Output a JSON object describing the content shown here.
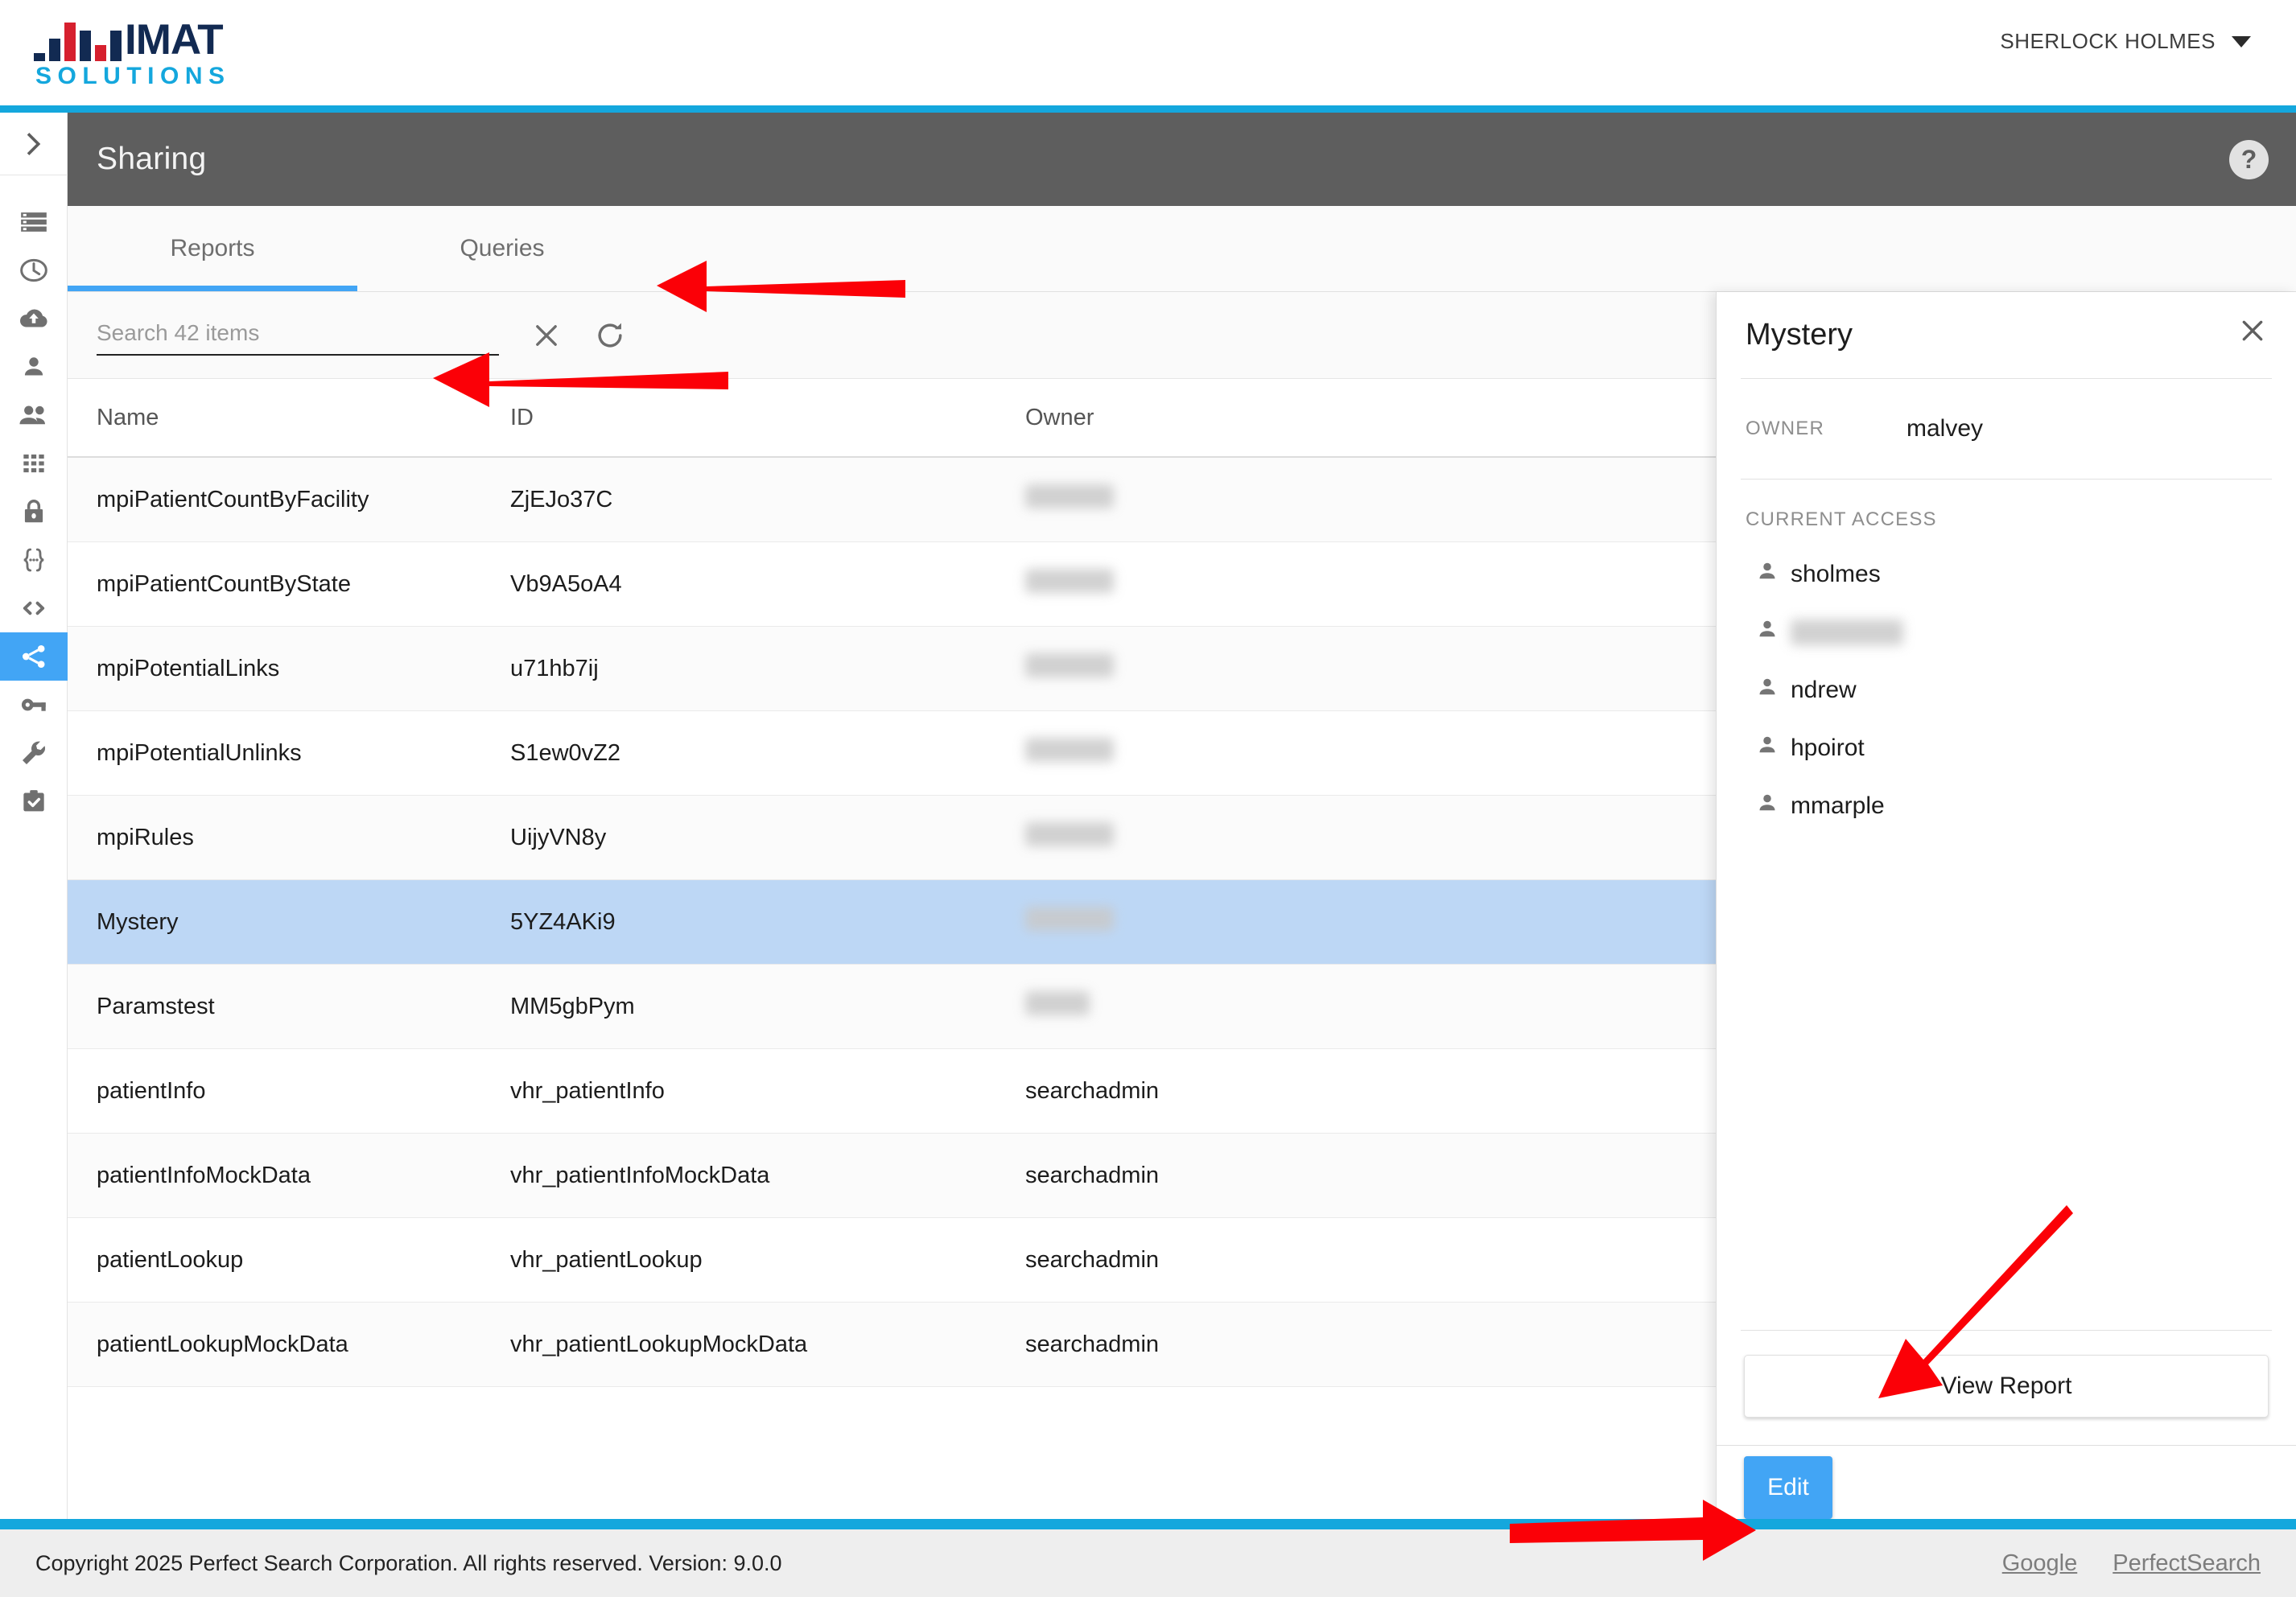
{
  "brand": {
    "name_primary": "IMAT",
    "name_secondary": "SOLUTIONS"
  },
  "header": {
    "user_name": "SHERLOCK HOLMES",
    "caret_icon": "chevron-down-icon"
  },
  "page": {
    "title": "Sharing",
    "help_label": "?"
  },
  "sidebar": {
    "toggle_icon": "chevron-right-icon",
    "items": [
      {
        "icon": "list-icon",
        "active": false
      },
      {
        "icon": "clock-icon",
        "active": false
      },
      {
        "icon": "cloud-upload-icon",
        "active": false
      },
      {
        "icon": "person-icon",
        "active": false
      },
      {
        "icon": "people-icon",
        "active": false
      },
      {
        "icon": "grid-icon",
        "active": false
      },
      {
        "icon": "lock-icon",
        "active": false
      },
      {
        "icon": "braces-icon",
        "active": false
      },
      {
        "icon": "code-icon",
        "active": false
      },
      {
        "icon": "share-icon",
        "active": true
      },
      {
        "icon": "key-icon",
        "active": false
      },
      {
        "icon": "wrench-icon",
        "active": false
      },
      {
        "icon": "clipboard-check-icon",
        "active": false
      }
    ]
  },
  "tabs": [
    {
      "label": "Reports",
      "active": true
    },
    {
      "label": "Queries",
      "active": false
    }
  ],
  "search": {
    "placeholder": "Search 42 items",
    "value": "",
    "clear_icon": "close-icon",
    "refresh_icon": "refresh-icon"
  },
  "table": {
    "columns": [
      "Name",
      "ID",
      "Owner"
    ],
    "rows": [
      {
        "name": "mpiPatientCountByFacility",
        "id": "ZjEJo37C",
        "owner": "",
        "owner_blurred": true,
        "selected": false
      },
      {
        "name": "mpiPatientCountByState",
        "id": "Vb9A5oA4",
        "owner": "",
        "owner_blurred": true,
        "selected": false
      },
      {
        "name": "mpiPotentialLinks",
        "id": "u71hb7ij",
        "owner": "",
        "owner_blurred": true,
        "selected": false
      },
      {
        "name": "mpiPotentialUnlinks",
        "id": "S1ew0vZ2",
        "owner": "",
        "owner_blurred": true,
        "selected": false
      },
      {
        "name": "mpiRules",
        "id": "UijyVN8y",
        "owner": "",
        "owner_blurred": true,
        "selected": false
      },
      {
        "name": "Mystery",
        "id": "5YZ4AKi9",
        "owner": "",
        "owner_blurred": true,
        "selected": true
      },
      {
        "name": "Paramstest",
        "id": "MM5gbPym",
        "owner": "",
        "owner_blurred": true,
        "selected": false
      },
      {
        "name": "patientInfo",
        "id": "vhr_patientInfo",
        "owner": "searchadmin",
        "owner_blurred": false,
        "selected": false
      },
      {
        "name": "patientInfoMockData",
        "id": "vhr_patientInfoMockData",
        "owner": "searchadmin",
        "owner_blurred": false,
        "selected": false
      },
      {
        "name": "patientLookup",
        "id": "vhr_patientLookup",
        "owner": "searchadmin",
        "owner_blurred": false,
        "selected": false
      },
      {
        "name": "patientLookupMockData",
        "id": "vhr_patientLookupMockData",
        "owner": "searchadmin",
        "owner_blurred": false,
        "selected": false
      }
    ]
  },
  "detail": {
    "title": "Mystery",
    "close_icon": "close-icon",
    "owner_label": "OWNER",
    "owner_value": "malvey",
    "access_label": "CURRENT ACCESS",
    "access_list": [
      {
        "name": "sholmes",
        "blurred": false
      },
      {
        "name": "",
        "blurred": true
      },
      {
        "name": "ndrew",
        "blurred": false
      },
      {
        "name": "hpoirot",
        "blurred": false
      },
      {
        "name": "mmarple",
        "blurred": false
      }
    ],
    "view_report_label": "View Report",
    "edit_label": "Edit"
  },
  "footer": {
    "copyright": "Copyright 2025 Perfect Search Corporation. All rights reserved. Version: 9.0.0",
    "links": [
      "Google",
      "PerfectSearch"
    ]
  },
  "colors": {
    "accent_cyan": "#14a7dd",
    "accent_blue": "#42a5f5",
    "header_gray": "#5e5e5e",
    "selected_row": "#bdd7f5",
    "annotation_red": "#fb0007",
    "logo_navy": "#122a52",
    "logo_red": "#d6202e"
  },
  "annotations": [
    {
      "target": "queries-tab",
      "type": "arrow-left"
    },
    {
      "target": "search-input",
      "type": "arrow-left"
    },
    {
      "target": "view-report-button",
      "type": "arrow-down-left"
    },
    {
      "target": "edit-button",
      "type": "arrow-right"
    }
  ]
}
